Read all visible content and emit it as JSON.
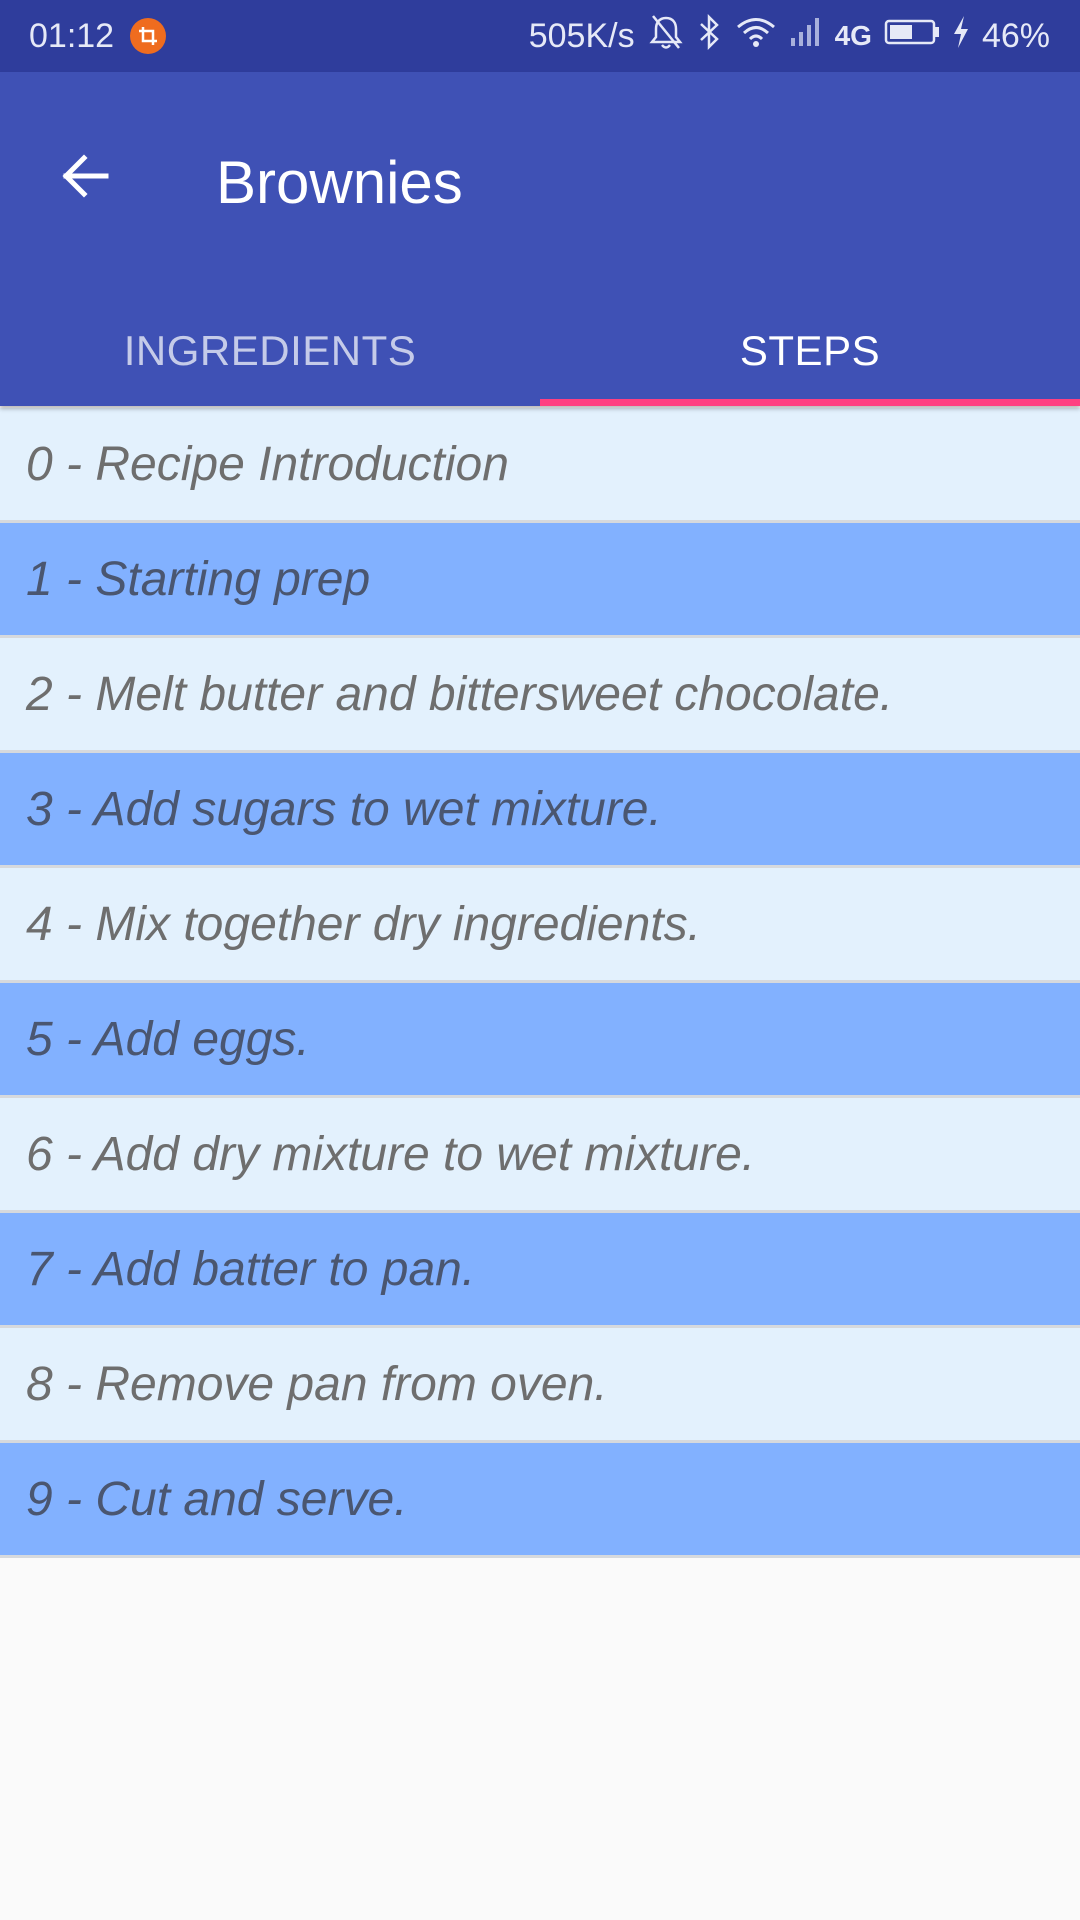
{
  "status_bar": {
    "time": "01:12",
    "speed": "505K/s",
    "network": "4G",
    "battery": "46%",
    "badge_color": "#ef6c1f",
    "icons": [
      "crop-icon",
      "alarm-off-icon",
      "bluetooth-icon",
      "wifi-icon",
      "signal-icon",
      "battery-icon",
      "charging-icon"
    ]
  },
  "toolbar": {
    "title": "Brownies",
    "back_icon": "arrow-back-icon",
    "background": "#3f51b5"
  },
  "tabs": [
    {
      "label": "INGREDIENTS",
      "selected": false
    },
    {
      "label": "STEPS",
      "selected": true
    }
  ],
  "colors": {
    "indicator": "#ff4081",
    "row_light": "#e3f1fd",
    "row_dark": "#82b1ff"
  },
  "steps": [
    {
      "label": "0 - Recipe Introduction"
    },
    {
      "label": "1 - Starting prep"
    },
    {
      "label": "2 - Melt butter and bittersweet chocolate."
    },
    {
      "label": "3 - Add sugars to wet mixture."
    },
    {
      "label": "4 - Mix together dry ingredients."
    },
    {
      "label": "5 - Add eggs."
    },
    {
      "label": "6 - Add dry mixture to wet mixture."
    },
    {
      "label": "7 - Add batter to pan."
    },
    {
      "label": "8 - Remove pan from oven."
    },
    {
      "label": "9 - Cut and serve."
    }
  ]
}
